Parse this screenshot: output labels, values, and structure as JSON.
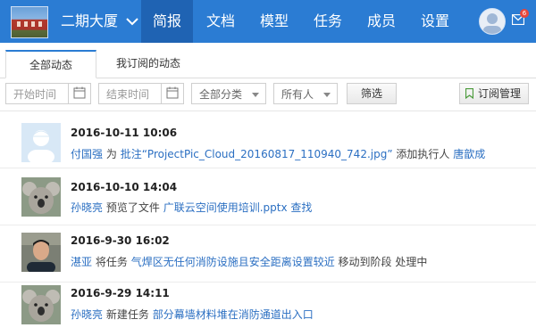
{
  "header": {
    "project_name": "二期大厦",
    "nav": [
      "简报",
      "文档",
      "模型",
      "任务",
      "成员",
      "设置"
    ],
    "active_nav": "简报",
    "mail_badge": "6",
    "accent": "#2b7cd3"
  },
  "tabs": [
    "全部动态",
    "我订阅的动态"
  ],
  "filters": {
    "start_placeholder": "开始时间",
    "end_placeholder": "结束时间",
    "category": "全部分类",
    "owner": "所有人",
    "filter_btn": "筛选",
    "subscribe_btn": "订阅管理"
  },
  "feed": [
    {
      "time": "2016-10-11 10:06",
      "user": "付国强",
      "w1": "为",
      "action": "批注",
      "target": "“ProjectPic_Cloud_20160817_110940_742.jpg”",
      "w2": "添加执行人",
      "extra": "唐歆成",
      "avatar": "default-user"
    },
    {
      "time": "2016-10-10 14:04",
      "user": "孙晓亮",
      "w1": "预览了文件",
      "target": "广联云空间使用培训.pptx",
      "extra": "查找",
      "avatar": "koala"
    },
    {
      "time": "2016-9-30 16:02",
      "user": "湛亚",
      "w1": "将任务",
      "target": "气焊区无任何消防设施且安全距离设置较近",
      "w2": "移动到阶段 处理中",
      "avatar": "person-photo"
    },
    {
      "time": "2016-9-29 14:11",
      "user": "孙晓亮",
      "w1": "新建任务",
      "target": "部分幕墙材料堆在消防通道出入口",
      "avatar": "koala"
    }
  ]
}
